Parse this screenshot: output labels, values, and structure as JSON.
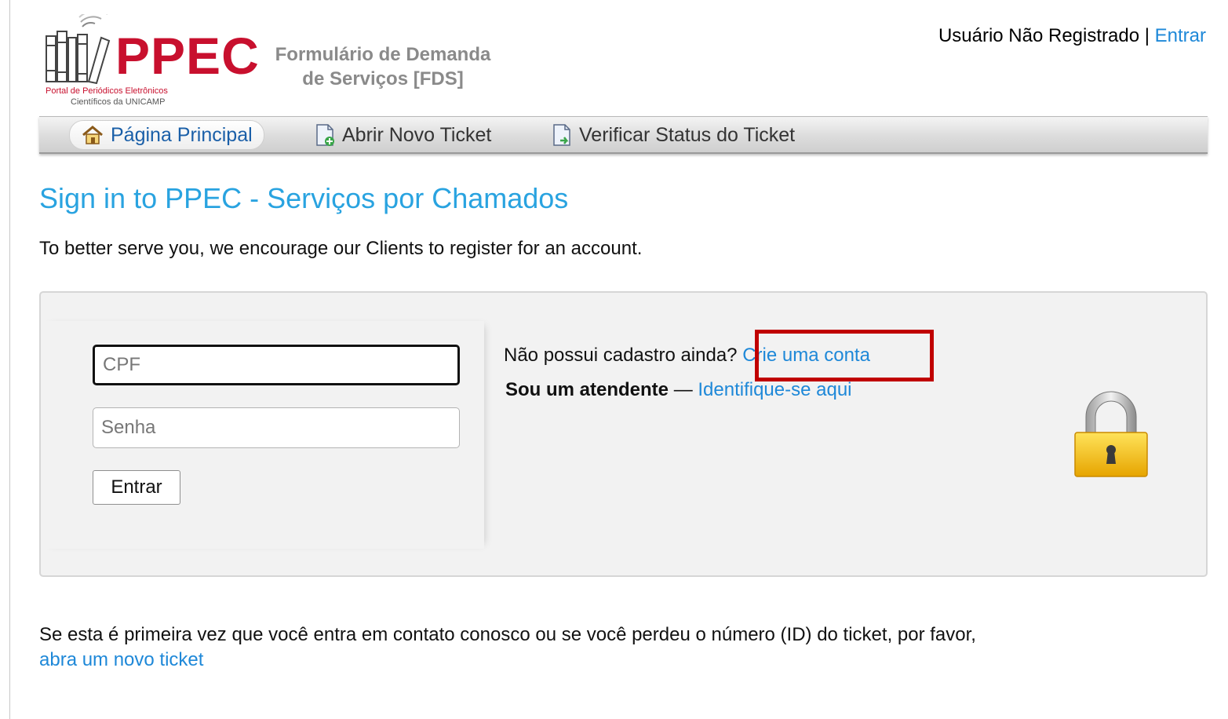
{
  "header": {
    "logo_text": "PPEC",
    "logo_sub1": "Portal de Periódicos Eletrônicos",
    "logo_sub2": "Científicos da UNICAMP",
    "form_title_line1": "Formulário de Demanda",
    "form_title_line2": "de Serviços [FDS]",
    "user_status": "Usuário Não Registrado",
    "separator": "|",
    "login_link": "Entrar"
  },
  "nav": {
    "items": [
      {
        "label": "Página Principal",
        "icon": "home-icon",
        "active": true
      },
      {
        "label": "Abrir Novo Ticket",
        "icon": "new-ticket-icon",
        "active": false
      },
      {
        "label": "Verificar Status do Ticket",
        "icon": "ticket-status-icon",
        "active": false
      }
    ]
  },
  "main": {
    "title": "Sign in to PPEC - Serviços por Chamados",
    "intro": "To better serve you, we encourage our Clients to register for an account."
  },
  "login": {
    "cpf_placeholder": "CPF",
    "password_placeholder": "Senha",
    "submit_label": "Entrar",
    "register_prompt": "Não possui cadastro ainda?",
    "register_link": "Crie uma conta",
    "agent_label": "Sou um atendente",
    "agent_dash": "—",
    "agent_link": "Identifique-se aqui"
  },
  "footer": {
    "text": "Se esta é primeira vez que você entra em contato conosco ou se você perdeu o número (ID) do ticket, por favor,",
    "link": "abra um novo ticket"
  },
  "colors": {
    "brand_red": "#c8102e",
    "link_blue": "#1e88d8",
    "title_blue": "#29a3e0",
    "highlight_red": "#c00000"
  }
}
